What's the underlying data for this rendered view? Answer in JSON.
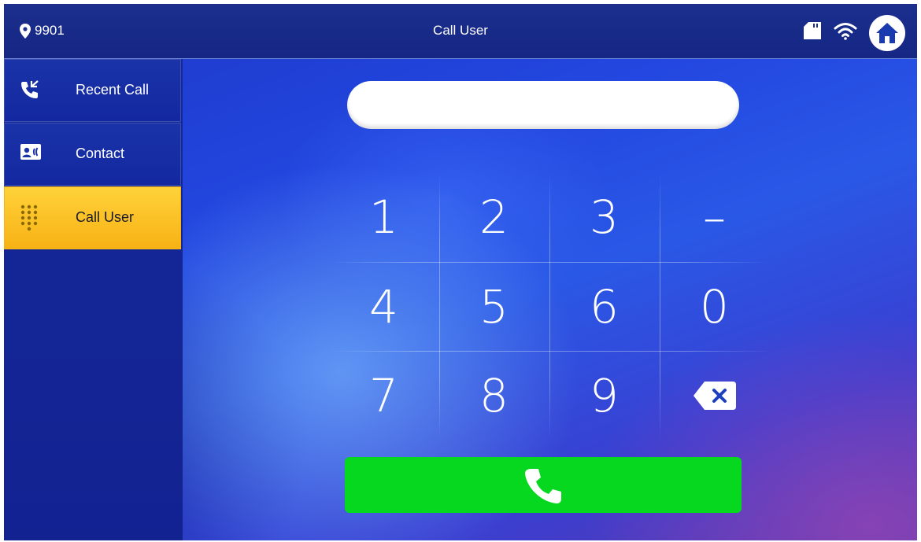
{
  "header": {
    "location": "9901",
    "title": "Call User"
  },
  "sidebar": {
    "items": [
      {
        "label": "Recent Call",
        "icon": "recent-call-icon",
        "active": false
      },
      {
        "label": "Contact",
        "icon": "contact-icon",
        "active": false
      },
      {
        "label": "Call User",
        "icon": "dialpad-icon",
        "active": true
      }
    ]
  },
  "dial_input": {
    "value": ""
  },
  "keypad": {
    "keys": [
      "1",
      "2",
      "3",
      "–",
      "4",
      "5",
      "6",
      "0",
      "7",
      "8",
      "9",
      "backspace-icon"
    ]
  },
  "colors": {
    "active_item": "#f7b214",
    "call_button": "#06d820",
    "topbar": "#1c2f8e"
  }
}
